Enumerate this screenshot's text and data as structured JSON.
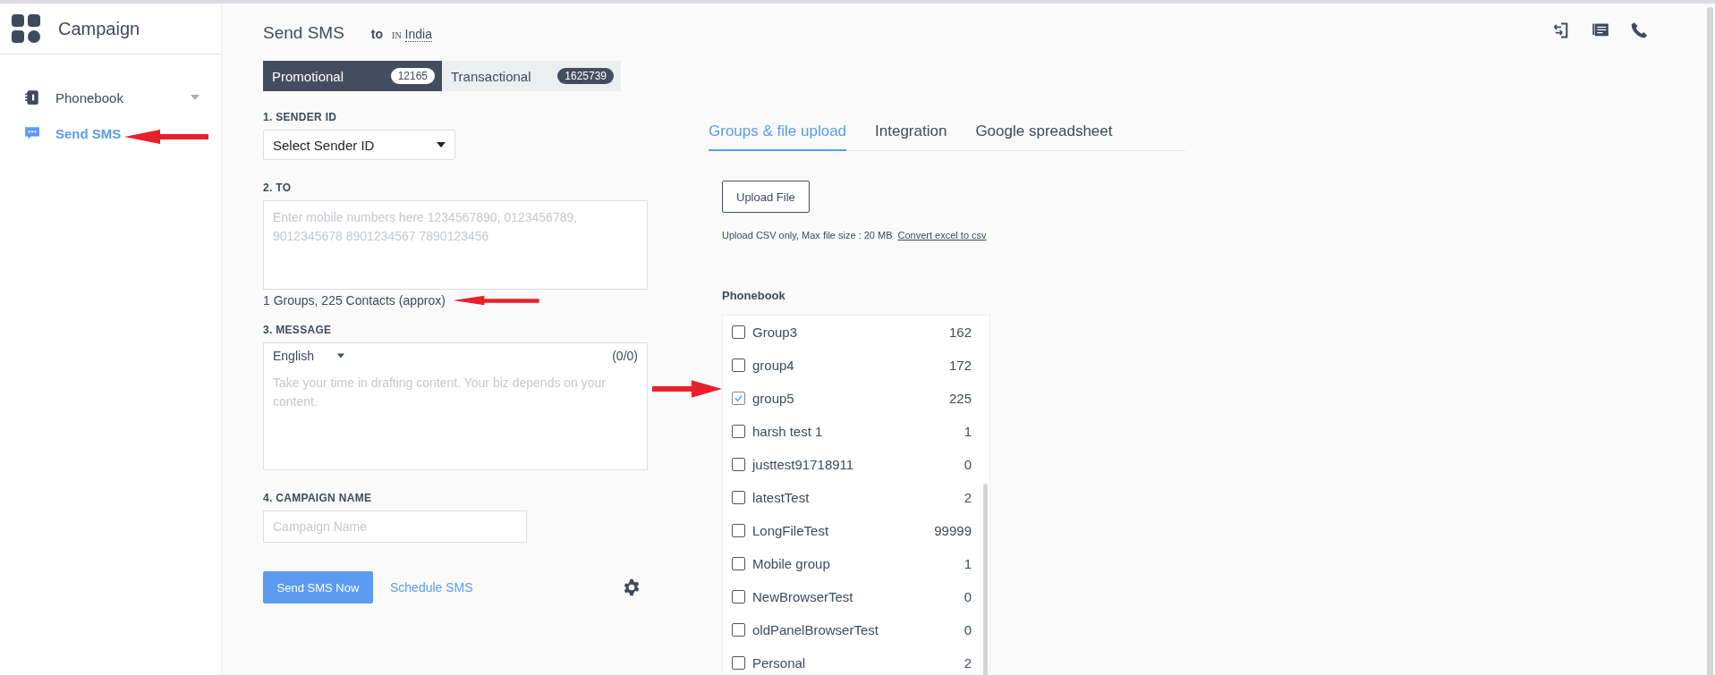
{
  "sidebar": {
    "app_title": "Campaign",
    "items": [
      {
        "label": "Phonebook",
        "kind": "expandable",
        "selected": false
      },
      {
        "label": "Send SMS",
        "kind": "plain",
        "selected": true
      }
    ]
  },
  "header": {
    "title": "Send SMS",
    "to_label": "to",
    "country_code": "IN",
    "country": "India"
  },
  "route_tabs": [
    {
      "label": "Promotional",
      "count": "12165",
      "selected": true
    },
    {
      "label": "Transactional",
      "count": "1625739",
      "selected": false
    }
  ],
  "form": {
    "sender_id": {
      "label": "1. SENDER ID",
      "value": "Select Sender ID"
    },
    "to": {
      "label": "2. TO",
      "placeholder": "Enter mobile numbers here 1234567890, 0123456789, 9012345678 8901234567 7890123456",
      "summary": "1 Groups, 225 Contacts (approx)"
    },
    "message": {
      "label": "3. MESSAGE",
      "language": "English",
      "counter": "(0/0)",
      "placeholder": "Take your time in drafting content. Your biz depends on your content."
    },
    "campaign_name": {
      "label": "4. CAMPAIGN NAME",
      "placeholder": "Campaign Name"
    }
  },
  "actions": {
    "primary": "Send SMS Now",
    "secondary": "Schedule SMS"
  },
  "source_tabs": [
    {
      "label": "Groups & file upload",
      "selected": true
    },
    {
      "label": "Integration",
      "selected": false
    },
    {
      "label": "Google spreadsheet",
      "selected": false
    }
  ],
  "upload": {
    "button": "Upload File",
    "hint": "Upload CSV only, Max file size : 20 MB",
    "link": "Convert excel to csv"
  },
  "phonebook": {
    "title": "Phonebook",
    "groups": [
      {
        "name": "Group3",
        "count": "162",
        "checked": false
      },
      {
        "name": "group4",
        "count": "172",
        "checked": false
      },
      {
        "name": "group5",
        "count": "225",
        "checked": true
      },
      {
        "name": "harsh test 1",
        "count": "1",
        "checked": false
      },
      {
        "name": "justtest91718911",
        "count": "0",
        "checked": false
      },
      {
        "name": "latestTest",
        "count": "2",
        "checked": false
      },
      {
        "name": "LongFileTest",
        "count": "99999",
        "checked": false
      },
      {
        "name": "Mobile group",
        "count": "1",
        "checked": false
      },
      {
        "name": "NewBrowserTest",
        "count": "0",
        "checked": false
      },
      {
        "name": "oldPanelBrowserTest",
        "count": "0",
        "checked": false
      },
      {
        "name": "Personal",
        "count": "2",
        "checked": false
      }
    ]
  }
}
